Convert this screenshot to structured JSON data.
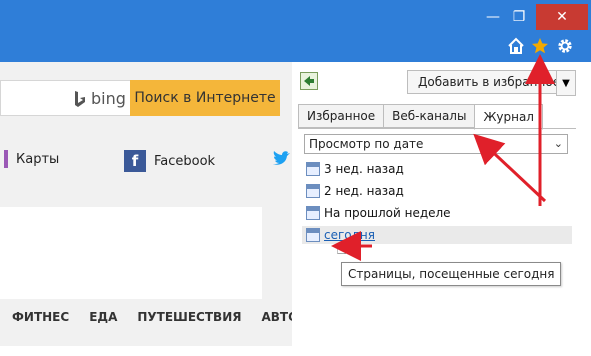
{
  "window": {
    "min_glyph": "—",
    "restore_glyph": "❐",
    "close_glyph": "✕"
  },
  "toolbar": {
    "home_icon": "home-icon",
    "favorites_icon": "star-icon",
    "settings_icon": "gear-icon"
  },
  "page": {
    "bing_label": "bing",
    "search_button": "Поиск в Интернете",
    "links": [
      {
        "label": "Карты"
      },
      {
        "label": "Facebook"
      }
    ],
    "nav": [
      "ФИТНЕС",
      "ЕДА",
      "ПУТЕШЕСТВИЯ",
      "АВТО"
    ]
  },
  "panel": {
    "add_favorites": "Добавить в избранное",
    "tabs": [
      "Избранное",
      "Веб-каналы",
      "Журнал"
    ],
    "active_tab": "Журнал",
    "view_select": "Просмотр по дате",
    "history": [
      {
        "label": "3 нед. назад"
      },
      {
        "label": "2 нед. назад"
      },
      {
        "label": "На прошлой неделе"
      },
      {
        "label": "сегодня"
      }
    ],
    "tooltip": "Страницы, посещенные сегодня"
  },
  "colors": {
    "titlebar": "#2f7ed8",
    "close": "#c83a32",
    "search_button": "#f4b63a",
    "star": "#f2a900",
    "arrow": "#e0202a",
    "link": "#1a5fb4"
  }
}
